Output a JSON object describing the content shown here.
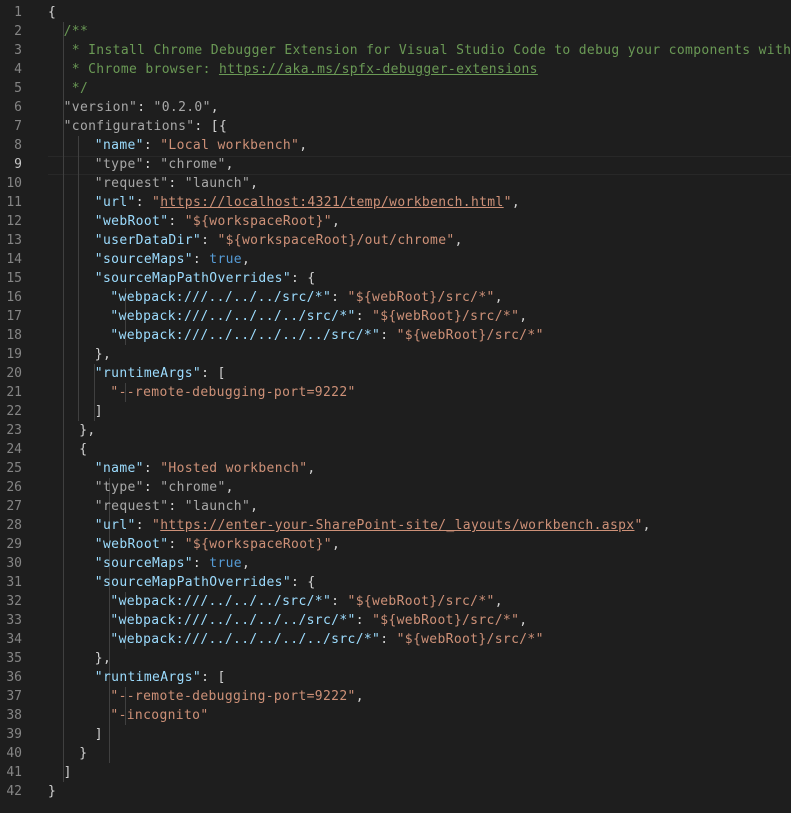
{
  "editor": {
    "active_line": 9,
    "line_numbers": [
      "1",
      "2",
      "3",
      "4",
      "5",
      "6",
      "7",
      "8",
      "9",
      "10",
      "11",
      "12",
      "13",
      "14",
      "15",
      "16",
      "17",
      "18",
      "19",
      "20",
      "21",
      "22",
      "23",
      "24",
      "25",
      "26",
      "27",
      "28",
      "29",
      "30",
      "31",
      "32",
      "33",
      "34",
      "35",
      "36",
      "37",
      "38",
      "39",
      "40",
      "41",
      "42"
    ],
    "lines": [
      {
        "indent": 0,
        "tokens": [
          {
            "t": "{",
            "c": "punc"
          }
        ]
      },
      {
        "indent": 1,
        "tokens": [
          {
            "t": "/**",
            "c": "com"
          }
        ]
      },
      {
        "indent": 1,
        "tokens": [
          {
            "t": " * Install Chrome Debugger Extension for Visual Studio Code to debug your components with the",
            "c": "com"
          }
        ]
      },
      {
        "indent": 1,
        "tokens": [
          {
            "t": " * Chrome browser: ",
            "c": "com"
          },
          {
            "t": "https://aka.ms/spfx-debugger-extensions",
            "c": "com",
            "link": true
          }
        ]
      },
      {
        "indent": 1,
        "tokens": [
          {
            "t": " */",
            "c": "com"
          }
        ]
      },
      {
        "indent": 1,
        "tokens": [
          {
            "t": "\"version\"",
            "c": "dim"
          },
          {
            "t": ": ",
            "c": "punc"
          },
          {
            "t": "\"0.2.0\"",
            "c": "dim"
          },
          {
            "t": ",",
            "c": "punc"
          }
        ]
      },
      {
        "indent": 1,
        "tokens": [
          {
            "t": "\"configurations\"",
            "c": "dim"
          },
          {
            "t": ": [{",
            "c": "punc"
          }
        ]
      },
      {
        "indent": 3,
        "tokens": [
          {
            "t": "\"name\"",
            "c": "key"
          },
          {
            "t": ": ",
            "c": "punc"
          },
          {
            "t": "\"Local workbench\"",
            "c": "str"
          },
          {
            "t": ",",
            "c": "punc"
          }
        ]
      },
      {
        "indent": 3,
        "tokens": [
          {
            "t": "\"type\"",
            "c": "dim"
          },
          {
            "t": ": ",
            "c": "punc"
          },
          {
            "t": "\"chrome\"",
            "c": "dim"
          },
          {
            "t": ",",
            "c": "punc"
          }
        ]
      },
      {
        "indent": 3,
        "tokens": [
          {
            "t": "\"request\"",
            "c": "dim"
          },
          {
            "t": ": ",
            "c": "punc"
          },
          {
            "t": "\"launch\"",
            "c": "dim"
          },
          {
            "t": ",",
            "c": "punc"
          }
        ]
      },
      {
        "indent": 3,
        "tokens": [
          {
            "t": "\"url\"",
            "c": "key"
          },
          {
            "t": ": ",
            "c": "punc"
          },
          {
            "t": "\"",
            "c": "str"
          },
          {
            "t": "https://localhost:4321/temp/workbench.html",
            "c": "str",
            "link": true
          },
          {
            "t": "\"",
            "c": "str"
          },
          {
            "t": ",",
            "c": "punc"
          }
        ]
      },
      {
        "indent": 3,
        "tokens": [
          {
            "t": "\"webRoot\"",
            "c": "key"
          },
          {
            "t": ": ",
            "c": "punc"
          },
          {
            "t": "\"${workspaceRoot}\"",
            "c": "str"
          },
          {
            "t": ",",
            "c": "punc"
          }
        ]
      },
      {
        "indent": 3,
        "tokens": [
          {
            "t": "\"userDataDir\"",
            "c": "key"
          },
          {
            "t": ": ",
            "c": "punc"
          },
          {
            "t": "\"${workspaceRoot}/out/chrome\"",
            "c": "str"
          },
          {
            "t": ",",
            "c": "punc"
          }
        ]
      },
      {
        "indent": 3,
        "tokens": [
          {
            "t": "\"sourceMaps\"",
            "c": "key"
          },
          {
            "t": ": ",
            "c": "punc"
          },
          {
            "t": "true",
            "c": "bool"
          },
          {
            "t": ",",
            "c": "punc"
          }
        ]
      },
      {
        "indent": 3,
        "tokens": [
          {
            "t": "\"sourceMapPathOverrides\"",
            "c": "key"
          },
          {
            "t": ": {",
            "c": "punc"
          }
        ]
      },
      {
        "indent": 4,
        "tokens": [
          {
            "t": "\"webpack:///../../../src/*\"",
            "c": "key"
          },
          {
            "t": ": ",
            "c": "punc"
          },
          {
            "t": "\"${webRoot}/src/*\"",
            "c": "str"
          },
          {
            "t": ",",
            "c": "punc"
          }
        ]
      },
      {
        "indent": 4,
        "tokens": [
          {
            "t": "\"webpack:///../../../../src/*\"",
            "c": "key"
          },
          {
            "t": ": ",
            "c": "punc"
          },
          {
            "t": "\"${webRoot}/src/*\"",
            "c": "str"
          },
          {
            "t": ",",
            "c": "punc"
          }
        ]
      },
      {
        "indent": 4,
        "tokens": [
          {
            "t": "\"webpack:///../../../../../src/*\"",
            "c": "key"
          },
          {
            "t": ": ",
            "c": "punc"
          },
          {
            "t": "\"${webRoot}/src/*\"",
            "c": "str"
          }
        ]
      },
      {
        "indent": 3,
        "tokens": [
          {
            "t": "},",
            "c": "punc"
          }
        ]
      },
      {
        "indent": 3,
        "tokens": [
          {
            "t": "\"runtimeArgs\"",
            "c": "key"
          },
          {
            "t": ": [",
            "c": "punc"
          }
        ]
      },
      {
        "indent": 4,
        "tokens": [
          {
            "t": "\"--remote-debugging-port=9222\"",
            "c": "str"
          }
        ]
      },
      {
        "indent": 3,
        "tokens": [
          {
            "t": "]",
            "c": "punc"
          }
        ]
      },
      {
        "indent": 2,
        "tokens": [
          {
            "t": "},",
            "c": "punc"
          }
        ]
      },
      {
        "indent": 2,
        "tokens": [
          {
            "t": "{",
            "c": "punc"
          }
        ]
      },
      {
        "indent": 3,
        "tokens": [
          {
            "t": "\"name\"",
            "c": "key"
          },
          {
            "t": ": ",
            "c": "punc"
          },
          {
            "t": "\"Hosted workbench\"",
            "c": "str"
          },
          {
            "t": ",",
            "c": "punc"
          }
        ]
      },
      {
        "indent": 3,
        "tokens": [
          {
            "t": "\"type\"",
            "c": "dim"
          },
          {
            "t": ": ",
            "c": "punc"
          },
          {
            "t": "\"chrome\"",
            "c": "dim"
          },
          {
            "t": ",",
            "c": "punc"
          }
        ]
      },
      {
        "indent": 3,
        "tokens": [
          {
            "t": "\"request\"",
            "c": "dim"
          },
          {
            "t": ": ",
            "c": "punc"
          },
          {
            "t": "\"launch\"",
            "c": "dim"
          },
          {
            "t": ",",
            "c": "punc"
          }
        ]
      },
      {
        "indent": 3,
        "tokens": [
          {
            "t": "\"url\"",
            "c": "key"
          },
          {
            "t": ": ",
            "c": "punc"
          },
          {
            "t": "\"",
            "c": "str"
          },
          {
            "t": "https://enter-your-SharePoint-site/_layouts/workbench.aspx",
            "c": "str",
            "link": true
          },
          {
            "t": "\"",
            "c": "str"
          },
          {
            "t": ",",
            "c": "punc"
          }
        ]
      },
      {
        "indent": 3,
        "tokens": [
          {
            "t": "\"webRoot\"",
            "c": "key"
          },
          {
            "t": ": ",
            "c": "punc"
          },
          {
            "t": "\"${workspaceRoot}\"",
            "c": "str"
          },
          {
            "t": ",",
            "c": "punc"
          }
        ]
      },
      {
        "indent": 3,
        "tokens": [
          {
            "t": "\"sourceMaps\"",
            "c": "key"
          },
          {
            "t": ": ",
            "c": "punc"
          },
          {
            "t": "true",
            "c": "bool"
          },
          {
            "t": ",",
            "c": "punc"
          }
        ]
      },
      {
        "indent": 3,
        "tokens": [
          {
            "t": "\"sourceMapPathOverrides\"",
            "c": "key"
          },
          {
            "t": ": {",
            "c": "punc"
          }
        ]
      },
      {
        "indent": 4,
        "tokens": [
          {
            "t": "\"webpack:///../../../src/*\"",
            "c": "key"
          },
          {
            "t": ": ",
            "c": "punc"
          },
          {
            "t": "\"${webRoot}/src/*\"",
            "c": "str"
          },
          {
            "t": ",",
            "c": "punc"
          }
        ]
      },
      {
        "indent": 4,
        "tokens": [
          {
            "t": "\"webpack:///../../../../src/*\"",
            "c": "key"
          },
          {
            "t": ": ",
            "c": "punc"
          },
          {
            "t": "\"${webRoot}/src/*\"",
            "c": "str"
          },
          {
            "t": ",",
            "c": "punc"
          }
        ]
      },
      {
        "indent": 4,
        "tokens": [
          {
            "t": "\"webpack:///../../../../../src/*\"",
            "c": "key"
          },
          {
            "t": ": ",
            "c": "punc"
          },
          {
            "t": "\"${webRoot}/src/*\"",
            "c": "str"
          }
        ]
      },
      {
        "indent": 3,
        "tokens": [
          {
            "t": "},",
            "c": "punc"
          }
        ]
      },
      {
        "indent": 3,
        "tokens": [
          {
            "t": "\"runtimeArgs\"",
            "c": "key"
          },
          {
            "t": ": [",
            "c": "punc"
          }
        ]
      },
      {
        "indent": 4,
        "tokens": [
          {
            "t": "\"--remote-debugging-port=9222\"",
            "c": "str"
          },
          {
            "t": ",",
            "c": "punc"
          }
        ]
      },
      {
        "indent": 4,
        "tokens": [
          {
            "t": "\"-incognito\"",
            "c": "str"
          }
        ]
      },
      {
        "indent": 3,
        "tokens": [
          {
            "t": "]",
            "c": "punc"
          }
        ]
      },
      {
        "indent": 2,
        "tokens": [
          {
            "t": "}",
            "c": "punc"
          }
        ]
      },
      {
        "indent": 1,
        "tokens": [
          {
            "t": "]",
            "c": "punc"
          }
        ]
      },
      {
        "indent": 0,
        "tokens": [
          {
            "t": "}",
            "c": "punc"
          }
        ]
      }
    ]
  },
  "colors": {
    "background": "#1e1e1e",
    "line_number": "#858585",
    "active_line_number": "#c6c6c6",
    "property_key": "#9cdcfe",
    "string": "#ce9178",
    "comment": "#6a9955",
    "boolean": "#569cd6",
    "punctuation": "#d4d4d4",
    "dimmed": "#a8a8a8"
  }
}
